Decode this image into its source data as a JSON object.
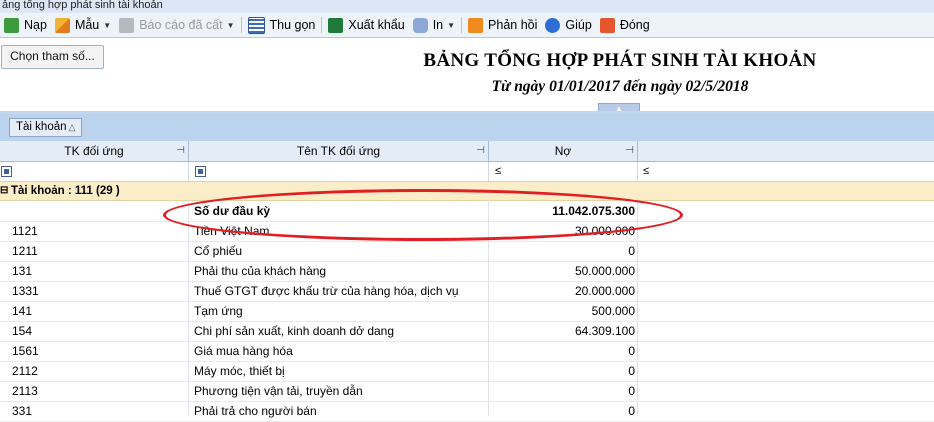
{
  "window": {
    "title": "ảng tổng hợp phát sinh tài khoản"
  },
  "toolbar": {
    "load": "Nạp",
    "template": "Mẫu",
    "saved_reports": "Báo cáo đã cất",
    "collapse": "Thu gọn",
    "export": "Xuất khẩu",
    "print": "In",
    "feedback": "Phản hồi",
    "help": "Giúp",
    "close": "Đóng"
  },
  "params_button": "Chọn tham số...",
  "report": {
    "title": "BẢNG TỔNG HỢP PHÁT SINH TÀI KHOẢN",
    "subtitle": "Từ ngày 01/01/2017 đến ngày 02/5/2018"
  },
  "group_panel": {
    "chip": "Tài khoản"
  },
  "columns": {
    "tk_doi_ung": "TK đối ứng",
    "ten_tk_doi_ung": "Tên TK đối ứng",
    "no": "Nợ"
  },
  "filter": {
    "no_op": "≤",
    "next_op": "≤"
  },
  "group_row": "Tài khoản : 111 (29 )",
  "rows": [
    {
      "tk": "",
      "ten": "Số dư đầu kỳ",
      "no": "11.042.075.300"
    },
    {
      "tk": "1121",
      "ten": "Tiền Việt Nam",
      "no": "30.000.000"
    },
    {
      "tk": "1211",
      "ten": "Cổ phiếu",
      "no": "0"
    },
    {
      "tk": "131",
      "ten": "Phải thu của khách hàng",
      "no": "50.000.000"
    },
    {
      "tk": "1331",
      "ten": "Thuế GTGT được khấu trừ của hàng hóa, dịch vụ",
      "no": "20.000.000"
    },
    {
      "tk": "141",
      "ten": "Tạm ứng",
      "no": "500.000"
    },
    {
      "tk": "154",
      "ten": "Chi phí sản xuất, kinh doanh dở dang",
      "no": "64.309.100"
    },
    {
      "tk": "1561",
      "ten": "Giá mua hàng hóa",
      "no": "0"
    },
    {
      "tk": "2112",
      "ten": "Máy móc, thiết bị",
      "no": "0"
    },
    {
      "tk": "2113",
      "ten": "Phương tiện vận tải, truyền dẫn",
      "no": "0"
    },
    {
      "tk": "331",
      "ten": "Phải trả cho người bán",
      "no": "0"
    }
  ],
  "colors": {
    "annotation": "#e01e24",
    "group_row_bg": "#fbedc7",
    "header_bg": "#e3ecf7"
  }
}
